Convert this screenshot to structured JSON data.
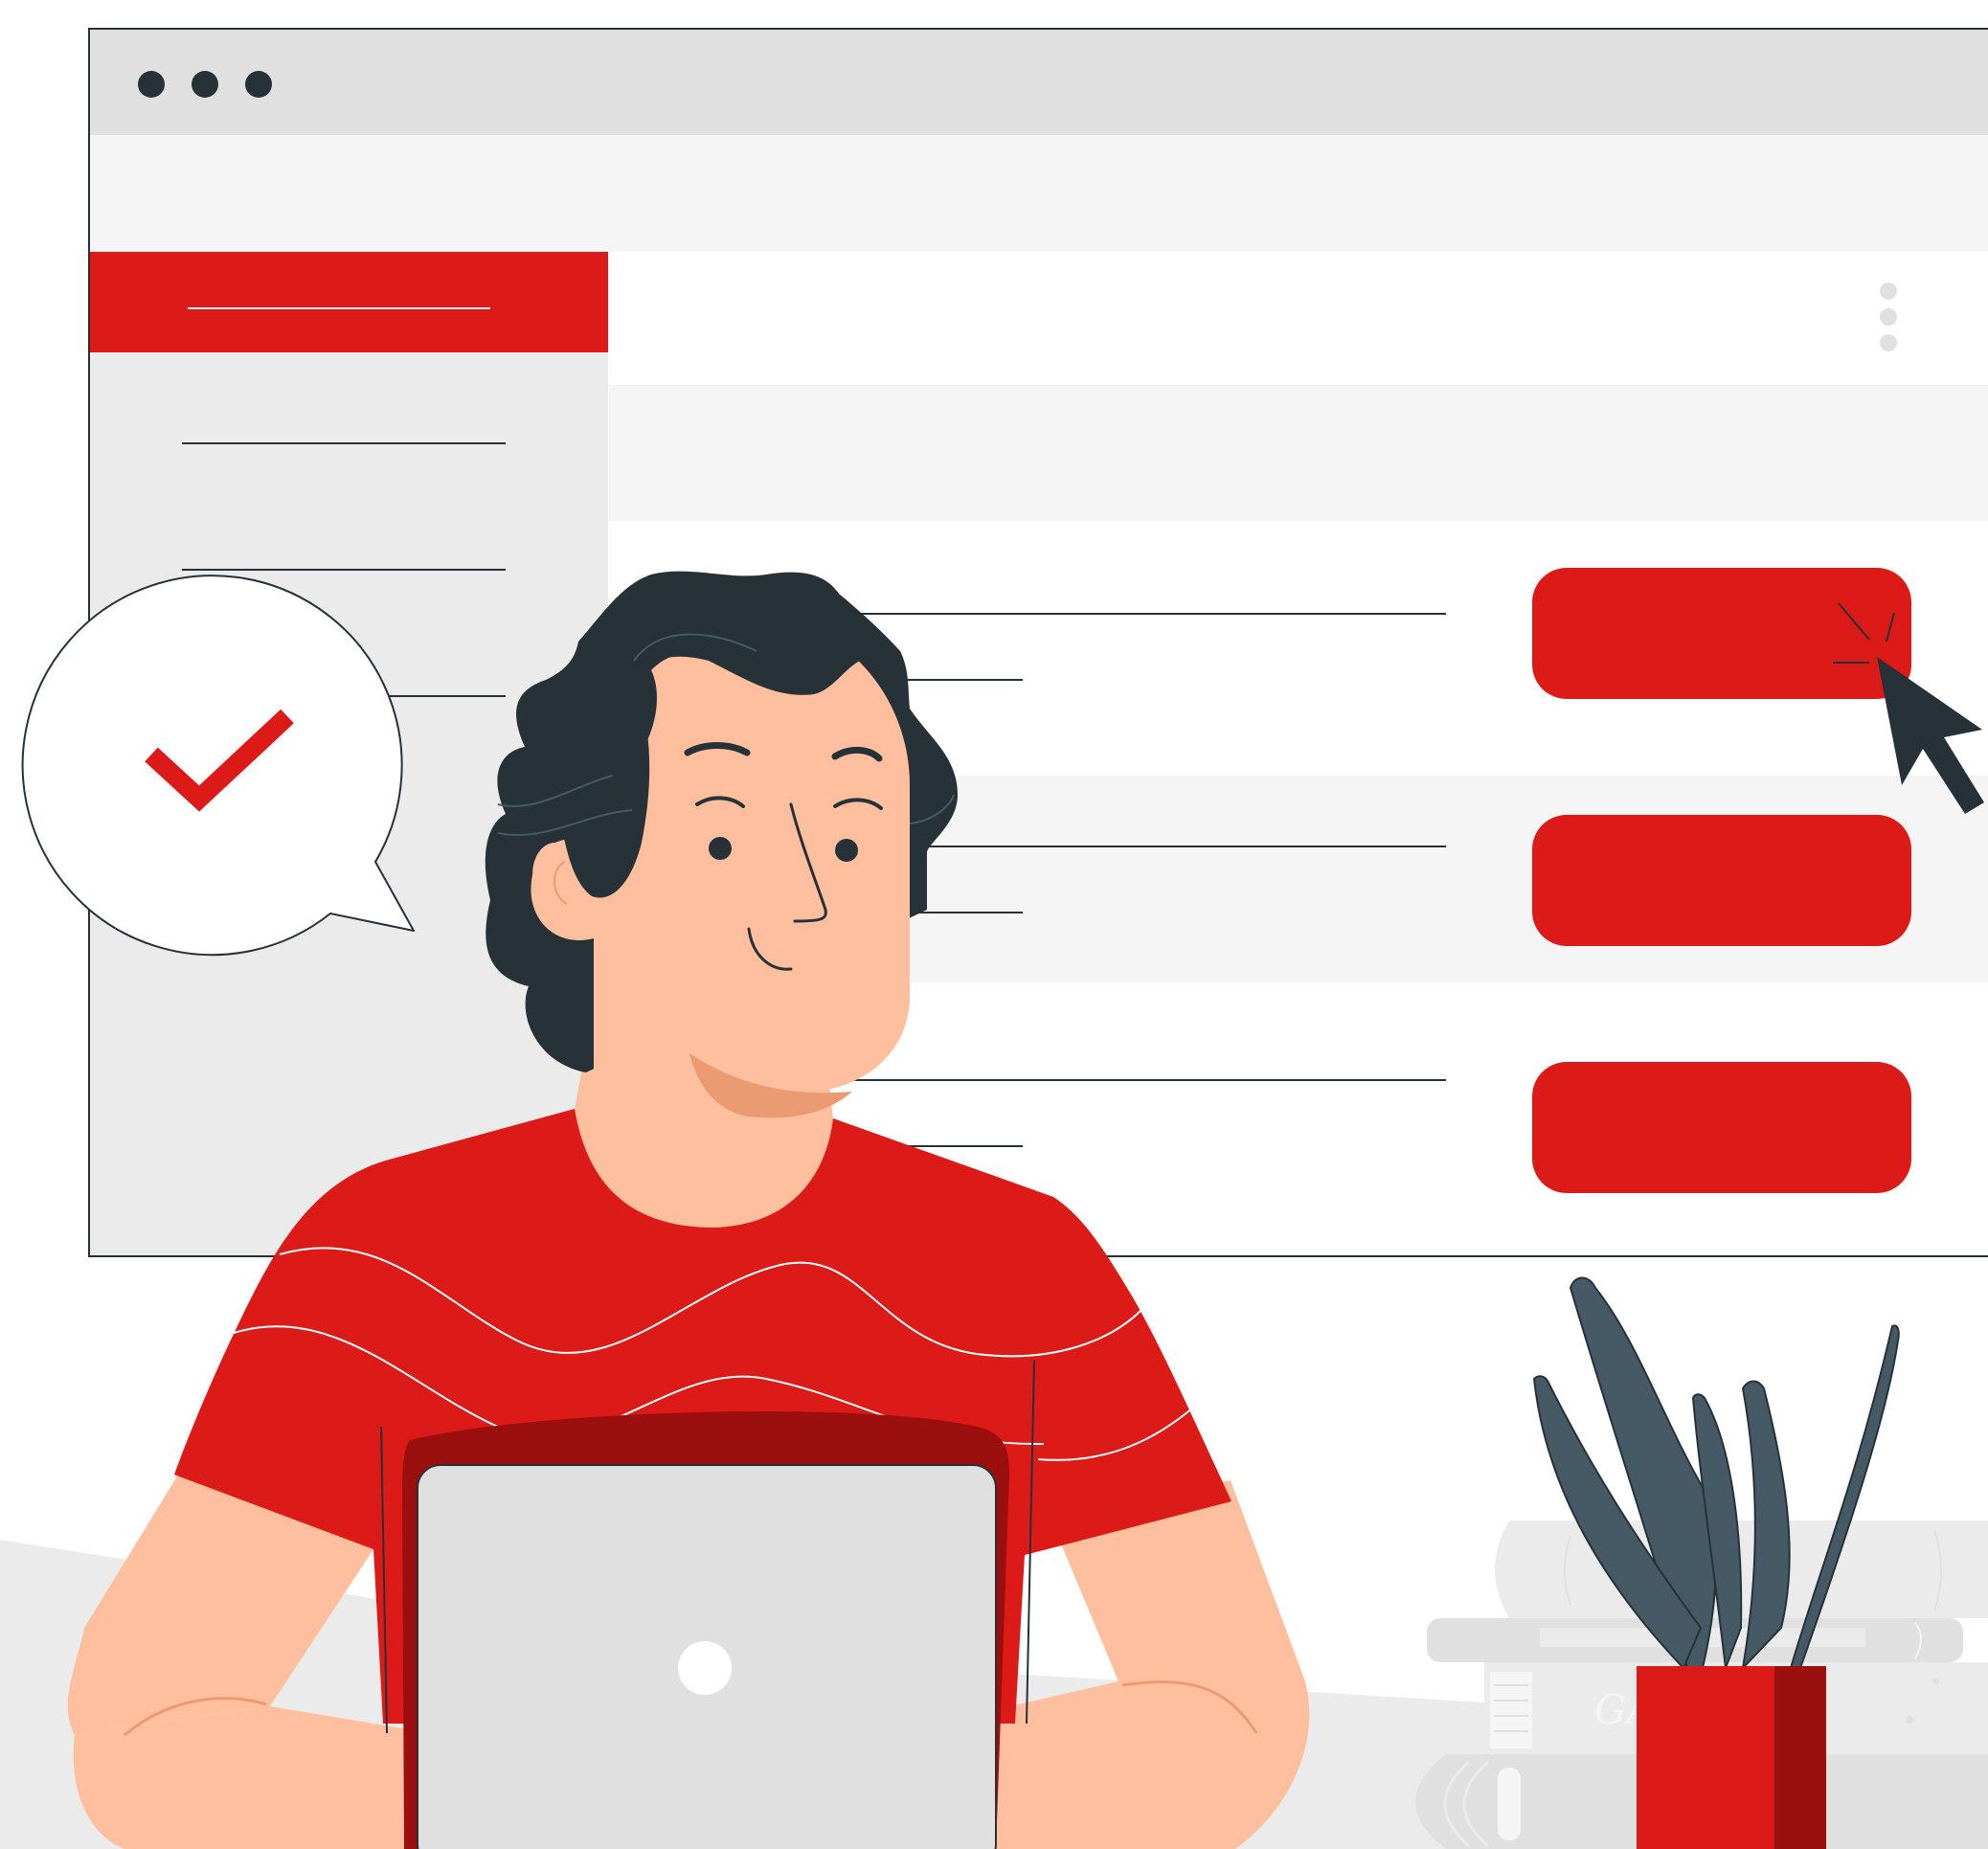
{
  "colors": {
    "accent_red": "#dc1a17",
    "dark_red": "#9b100f",
    "ink": "#263238",
    "skin": "#fdbf9e",
    "skin_shadow": "#eb9b72",
    "chrome_gray": "#e0e0e0",
    "panel_gray": "#ebebeb",
    "light_row": "#f5f5f5",
    "plant_leaf": "#455a64"
  },
  "icons": {
    "window_controls": "three-dots-icon",
    "kebab_menu": "vertical-dots-icon",
    "bubble_mark": "checkmark-icon",
    "pointer": "mouse-cursor-icon",
    "laptop_logo": "circle-logo-icon"
  },
  "book_spine_text": "GA",
  "action_buttons": [
    {
      "state": "clicked"
    },
    {
      "state": "idle"
    },
    {
      "state": "idle"
    }
  ]
}
